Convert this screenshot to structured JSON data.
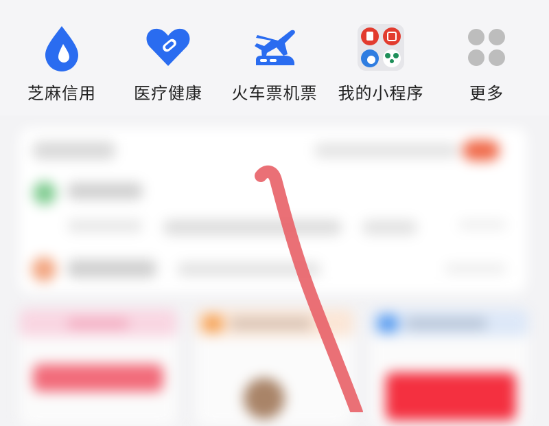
{
  "quick_entries": [
    {
      "label": "芝麻信用",
      "icon": "sesame-credit-drop-icon",
      "color": "#2a6cf0"
    },
    {
      "label": "医疗健康",
      "icon": "health-heart-icon",
      "color": "#2a6cf0"
    },
    {
      "label": "火车票机票",
      "icon": "train-plane-ticket-icon",
      "color": "#2a6cf0"
    },
    {
      "label": "我的小程序",
      "icon": "mini-program-grid-icon",
      "color": "#e64a3b"
    },
    {
      "label": "更多",
      "icon": "more-grid-icon",
      "color": "#bdbdbd"
    }
  ],
  "annotation": {
    "stroke_color": "#e8646a"
  }
}
